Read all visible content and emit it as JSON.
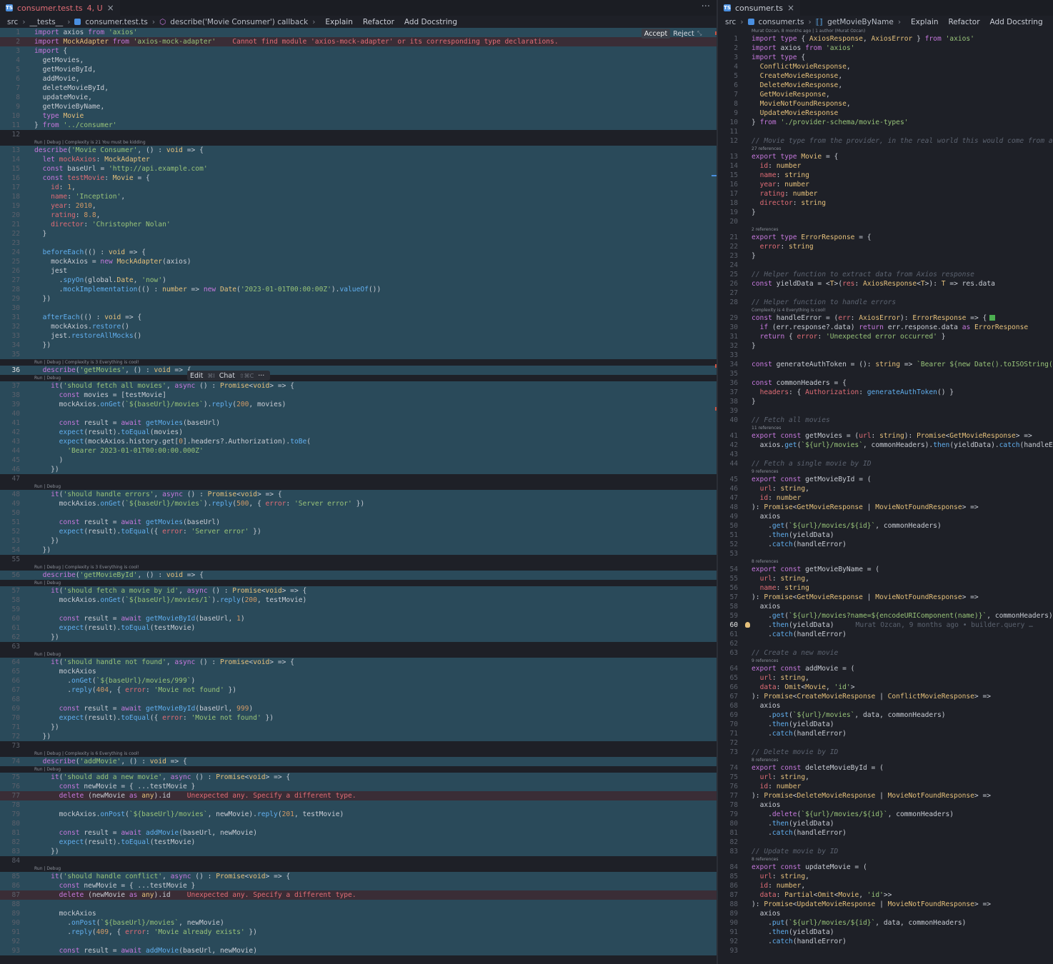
{
  "left": {
    "tab": {
      "label": "consumer.test.ts",
      "status": "4, U"
    },
    "breadcrumbs": [
      "src",
      "__tests__",
      "consumer.test.ts",
      "describe('Movie Consumer') callback"
    ],
    "actions": [
      "Explain",
      "Refactor",
      "Add Docstring"
    ],
    "diff": {
      "accept": "Accept",
      "reject": "Reject"
    },
    "inline_menu": {
      "edit": "Edit",
      "edit_key": "⌘I",
      "chat": "Chat",
      "chat_key": "⇧⌘C",
      "more": "···"
    },
    "lenses": [
      {
        "before": 13,
        "text": "Run | Debug | Complexity is 21 You must be kidding"
      },
      {
        "before": 36,
        "text": "Run | Debug | Complexity is 3 Everything is cool!"
      },
      {
        "before": 37,
        "text": "Run | Debug"
      },
      {
        "before": 48,
        "text": "Run | Debug"
      },
      {
        "before": 56,
        "text": "Run | Debug | Complexity is 3 Everything is cool!"
      },
      {
        "before": 57,
        "text": "Run | Debug"
      },
      {
        "before": 64,
        "text": "Run | Debug"
      },
      {
        "before": 74,
        "text": "Run | Debug | Complexity is 6 Everything is cool!"
      },
      {
        "before": 75,
        "text": "Run | Debug"
      },
      {
        "before": 85,
        "text": "Run | Debug"
      }
    ],
    "lines": [
      "import axios from 'axios'",
      "import MockAdapter from 'axios-mock-adapter'    Cannot find module 'axios-mock-adapter' or its corresponding type declarations.",
      "import {",
      "  getMovies,",
      "  getMovieById,",
      "  addMovie,",
      "  deleteMovieById,",
      "  updateMovie,",
      "  getMovieByName,",
      "  type Movie",
      "} from '../consumer'",
      "",
      "describe('Movie Consumer', () : void => {",
      "  let mockAxios: MockAdapter",
      "  const baseUrl = 'http://api.example.com'",
      "  const testMovie: Movie = {",
      "    id: 1,",
      "    name: 'Inception',",
      "    year: 2010,",
      "    rating: 8.8,",
      "    director: 'Christopher Nolan'",
      "  }",
      "",
      "  beforeEach(() : void => {",
      "    mockAxios = new MockAdapter(axios)",
      "    jest",
      "      .spyOn(global.Date, 'now')",
      "      .mockImplementation(() : number => new Date('2023-01-01T00:00:00Z').valueOf())",
      "  })",
      "",
      "  afterEach(() : void => {",
      "    mockAxios.restore()",
      "    jest.restoreAllMocks()",
      "  })",
      "",
      "  describe('getMovies', () : void => {",
      "    it('should fetch all movies', async () : Promise<void> => {",
      "      const movies = [testMovie]",
      "      mockAxios.onGet(`${baseUrl}/movies`).reply(200, movies)",
      "",
      "      const result = await getMovies(baseUrl)",
      "      expect(result).toEqual(movies)",
      "      expect(mockAxios.history.get[0].headers?.Authorization).toBe(",
      "        'Bearer 2023-01-01T00:00:00.000Z'",
      "      )",
      "    })",
      "",
      "    it('should handle errors', async () : Promise<void> => {",
      "      mockAxios.onGet(`${baseUrl}/movies`).reply(500, { error: 'Server error' })",
      "",
      "      const result = await getMovies(baseUrl)",
      "      expect(result).toEqual({ error: 'Server error' })",
      "    })",
      "  })",
      "",
      "  describe('getMovieById', () : void => {",
      "    it('should fetch a movie by id', async () : Promise<void> => {",
      "      mockAxios.onGet(`${baseUrl}/movies/1`).reply(200, testMovie)",
      "",
      "      const result = await getMovieById(baseUrl, 1)",
      "      expect(result).toEqual(testMovie)",
      "    })",
      "",
      "    it('should handle not found', async () : Promise<void> => {",
      "      mockAxios",
      "        .onGet(`${baseUrl}/movies/999`)",
      "        .reply(404, { error: 'Movie not found' })",
      "",
      "      const result = await getMovieById(baseUrl, 999)",
      "      expect(result).toEqual({ error: 'Movie not found' })",
      "    })",
      "  })",
      "",
      "  describe('addMovie', () : void => {",
      "    it('should add a new movie', async () : Promise<void> => {",
      "      const newMovie = { ...testMovie }",
      "      delete (newMovie as any).id    Unexpected any. Specify a different type.",
      "",
      "      mockAxios.onPost(`${baseUrl}/movies`, newMovie).reply(201, testMovie)",
      "",
      "      const result = await addMovie(baseUrl, newMovie)",
      "      expect(result).toEqual(testMovie)",
      "    })",
      "",
      "    it('should handle conflict', async () : Promise<void> => {",
      "      const newMovie = { ...testMovie }",
      "      delete (newMovie as any).id    Unexpected any. Specify a different type.",
      "",
      "      mockAxios",
      "        .onPost(`${baseUrl}/movies`, newMovie)",
      "        .reply(409, { error: 'Movie already exists' })",
      "",
      "      const result = await addMovie(baseUrl, newMovie)"
    ]
  },
  "right": {
    "tab": {
      "label": "consumer.ts"
    },
    "breadcrumbs": [
      "src",
      "consumer.ts",
      "getMovieByName"
    ],
    "actions": [
      "Explain",
      "Refactor",
      "Add Docstring"
    ],
    "lenses": [
      {
        "before": 1,
        "text": "Murat Ozcan, 8 months ago | 1 author (Murat Ozcan)"
      },
      {
        "before": 13,
        "text": "27 references"
      },
      {
        "before": 21,
        "text": "2 references"
      },
      {
        "before": 29,
        "text": "Complexity is 4 Everything is cool!"
      },
      {
        "before": 41,
        "text": "11 references"
      },
      {
        "before": 45,
        "text": "9 references"
      },
      {
        "before": 54,
        "text": "8 references"
      },
      {
        "before": 64,
        "text": "9 references"
      },
      {
        "before": 74,
        "text": "8 references"
      },
      {
        "before": 84,
        "text": "8 references"
      }
    ],
    "blame": "Murat Ozcan, 9 months ago • builder.query …",
    "lines": [
      "import type { AxiosResponse, AxiosError } from 'axios'",
      "import axios from 'axios'",
      "import type {",
      "  ConflictMovieResponse,",
      "  CreateMovieResponse,",
      "  DeleteMovieResponse,",
      "  GetMovieResponse,",
      "  MovieNotFoundResponse,",
      "  UpdateMovieResponse",
      "} from './provider-schema/movie-types'",
      "",
      "// Movie type from the provider, in the real world this would come from a publis",
      "export type Movie = {",
      "  id: number",
      "  name: string",
      "  year: number",
      "  rating: number",
      "  director: string",
      "}",
      "",
      "export type ErrorResponse = {",
      "  error: string",
      "}",
      "",
      "// Helper function to extract data from Axios response",
      "const yieldData = <T>(res: AxiosResponse<T>): T => res.data",
      "",
      "// Helper function to handle errors",
      "const handleError = (err: AxiosError): ErrorResponse => {",
      "  if (err.response?.data) return err.response.data as ErrorResponse",
      "  return { error: 'Unexpected error occurred' }",
      "}",
      "",
      "const generateAuthToken = (): string => `Bearer ${new Date().toISOString()}`",
      "",
      "const commonHeaders = {",
      "  headers: { Authorization: generateAuthToken() }",
      "}",
      "",
      "// Fetch all movies",
      "export const getMovies = (url: string): Promise<GetMovieResponse> =>",
      "  axios.get(`${url}/movies`, commonHeaders).then(yieldData).catch(handleError)",
      "",
      "// Fetch a single movie by ID",
      "export const getMovieById = (",
      "  url: string,",
      "  id: number",
      "): Promise<GetMovieResponse | MovieNotFoundResponse> =>",
      "  axios",
      "    .get(`${url}/movies/${id}`, commonHeaders)",
      "    .then(yieldData)",
      "    .catch(handleError)",
      "",
      "export const getMovieByName = (",
      "  url: string,",
      "  name: string",
      "): Promise<GetMovieResponse | MovieNotFoundResponse> =>",
      "  axios",
      "    .get(`${url}/movies?name=${encodeURIComponent(name)}`, commonHeaders)",
      "    .then(yieldData)",
      "    .catch(handleError)",
      "",
      "// Create a new movie",
      "export const addMovie = (",
      "  url: string,",
      "  data: Omit<Movie, 'id'>",
      "): Promise<CreateMovieResponse | ConflictMovieResponse> =>",
      "  axios",
      "    .post(`${url}/movies`, data, commonHeaders)",
      "    .then(yieldData)",
      "    .catch(handleError)",
      "",
      "// Delete movie by ID",
      "export const deleteMovieById = (",
      "  url: string,",
      "  id: number",
      "): Promise<DeleteMovieResponse | MovieNotFoundResponse> =>",
      "  axios",
      "    .delete(`${url}/movies/${id}`, commonHeaders)",
      "    .then(yieldData)",
      "    .catch(handleError)",
      "",
      "// Update movie by ID",
      "export const updateMovie = (",
      "  url: string,",
      "  id: number,",
      "  data: Partial<Omit<Movie, 'id'>>",
      "): Promise<UpdateMovieResponse | MovieNotFoundResponse> =>",
      "  axios",
      "    .put(`${url}/movies/${id}`, data, commonHeaders)",
      "    .then(yieldData)",
      "    .catch(handleError)",
      ""
    ]
  },
  "colors": {
    "keyword": "#c678dd",
    "function": "#61afef",
    "string": "#98c379",
    "number": "#d19a66",
    "type": "#e5c07b",
    "comment": "#5c6370",
    "error": "#e06c75",
    "diff_added": "#2a4a5a"
  }
}
